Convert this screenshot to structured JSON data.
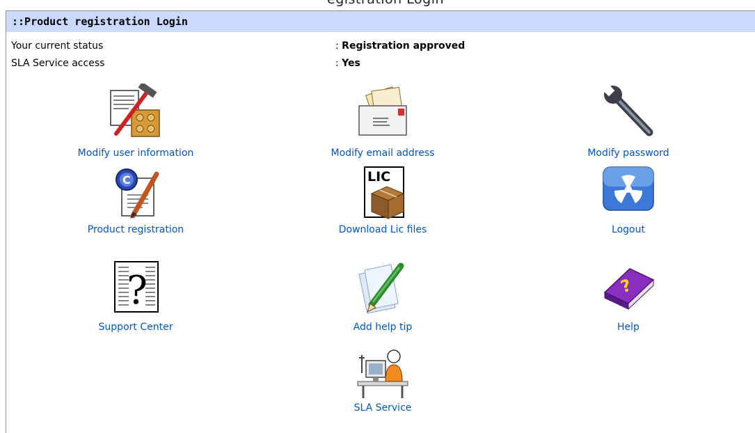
{
  "page": {
    "header_text": "egistration Login",
    "panel_title": "::Product registration Login"
  },
  "status": {
    "current_status_label": "Your current status",
    "current_status_value": "Registration approved",
    "sla_label": "SLA Service access",
    "sla_value": "Yes"
  },
  "tiles": [
    {
      "label": "Modify user information",
      "icon": "tools-document-icon"
    },
    {
      "label": "Modify email address",
      "icon": "envelope-icon"
    },
    {
      "label": "Modify password",
      "icon": "wrench-icon"
    },
    {
      "label": "Product registration",
      "icon": "certificate-pen-icon"
    },
    {
      "label": "Download Lic files",
      "icon": "license-package-icon"
    },
    {
      "label": "Logout",
      "icon": "radiation-logout-icon"
    },
    {
      "label": "Support Center",
      "icon": "question-document-icon"
    },
    {
      "label": "Add help tip",
      "icon": "pen-paper-icon"
    },
    {
      "label": "Help",
      "icon": "help-book-icon"
    },
    {
      "label": "SLA Service",
      "icon": "support-desk-icon"
    }
  ],
  "colors": {
    "title_bar": "#ccd9ff",
    "link": "#0055cc"
  }
}
